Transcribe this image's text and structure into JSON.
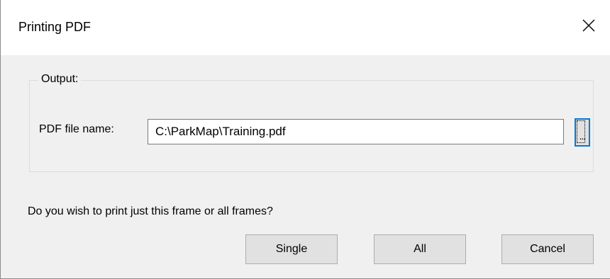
{
  "window": {
    "title": "Printing PDF",
    "close_icon": "close-icon"
  },
  "output_group": {
    "label": "Output:",
    "filename_label": "PDF file name:",
    "filename_value": "C:\\ParkMap\\Training.pdf",
    "browse_label": "..."
  },
  "prompt": {
    "question": "Do you wish to print just this frame or all frames?"
  },
  "buttons": {
    "single": "Single",
    "all": "All",
    "cancel": "Cancel"
  },
  "colors": {
    "focus_accent": "#0078d7",
    "dialog_background": "#f0f0f0",
    "titlebar_background": "#ffffff"
  }
}
